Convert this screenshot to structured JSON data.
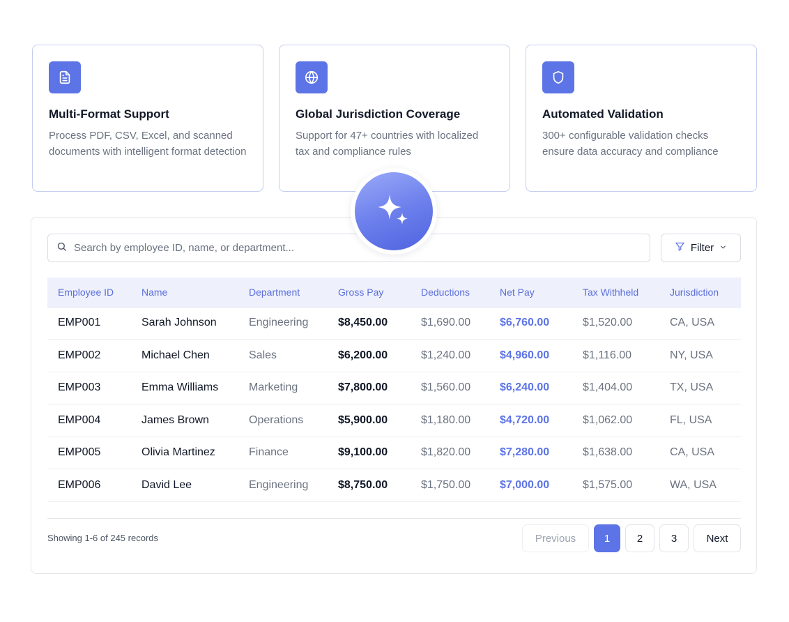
{
  "features": [
    {
      "icon": "document-icon",
      "title": "Multi-Format Support",
      "description": "Process PDF, CSV, Excel, and scanned documents with intelligent format detection"
    },
    {
      "icon": "globe-icon",
      "title": "Global Jurisdiction Coverage",
      "description": "Support for 47+ countries with localized tax and compliance rules"
    },
    {
      "icon": "shield-icon",
      "title": "Automated Validation",
      "description": "300+ configurable validation checks ensure data accuracy and compliance"
    }
  ],
  "center_badge": {
    "icon": "sparkle-icon"
  },
  "search": {
    "placeholder": "Search by employee ID, name, or department...",
    "value": ""
  },
  "filter": {
    "label": "Filter"
  },
  "table": {
    "headers": [
      "Employee ID",
      "Name",
      "Department",
      "Gross Pay",
      "Deductions",
      "Net Pay",
      "Tax Withheld",
      "Jurisdiction"
    ],
    "rows": [
      {
        "id": "EMP001",
        "name": "Sarah Johnson",
        "department": "Engineering",
        "gross": "$8,450.00",
        "deductions": "$1,690.00",
        "net": "$6,760.00",
        "tax": "$1,520.00",
        "jurisdiction": "CA, USA"
      },
      {
        "id": "EMP002",
        "name": "Michael Chen",
        "department": "Sales",
        "gross": "$6,200.00",
        "deductions": "$1,240.00",
        "net": "$4,960.00",
        "tax": "$1,116.00",
        "jurisdiction": "NY, USA"
      },
      {
        "id": "EMP003",
        "name": "Emma Williams",
        "department": "Marketing",
        "gross": "$7,800.00",
        "deductions": "$1,560.00",
        "net": "$6,240.00",
        "tax": "$1,404.00",
        "jurisdiction": "TX, USA"
      },
      {
        "id": "EMP004",
        "name": "James Brown",
        "department": "Operations",
        "gross": "$5,900.00",
        "deductions": "$1,180.00",
        "net": "$4,720.00",
        "tax": "$1,062.00",
        "jurisdiction": "FL, USA"
      },
      {
        "id": "EMP005",
        "name": "Olivia Martinez",
        "department": "Finance",
        "gross": "$9,100.00",
        "deductions": "$1,820.00",
        "net": "$7,280.00",
        "tax": "$1,638.00",
        "jurisdiction": "CA, USA"
      },
      {
        "id": "EMP006",
        "name": "David Lee",
        "department": "Engineering",
        "gross": "$8,750.00",
        "deductions": "$1,750.00",
        "net": "$7,000.00",
        "tax": "$1,575.00",
        "jurisdiction": "WA, USA"
      }
    ]
  },
  "pagination": {
    "summary": "Showing 1-6 of 245 records",
    "previous": "Previous",
    "pages": [
      "1",
      "2",
      "3"
    ],
    "current": "1",
    "next": "Next"
  },
  "colors": {
    "accent": "#5c74e6",
    "header_bg": "#eef0fc",
    "muted_text": "#6b7280"
  }
}
